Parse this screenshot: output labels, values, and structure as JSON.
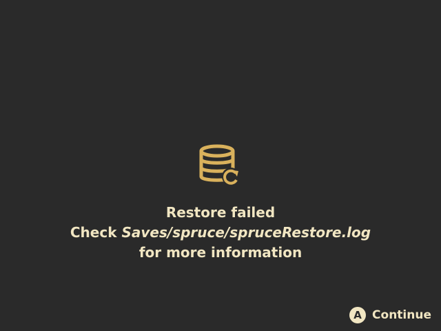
{
  "dialog": {
    "icon": "database-restore-icon",
    "title": "Restore failed",
    "check_prefix": "Check ",
    "log_path": "Saves/spruce/spruceRestore.log",
    "info_line": "for more information"
  },
  "footer": {
    "button_glyph": "A",
    "continue_label": "Continue"
  },
  "colors": {
    "background": "#2a2a2a",
    "text": "#f1e6c2",
    "icon": "#d9b15c"
  }
}
